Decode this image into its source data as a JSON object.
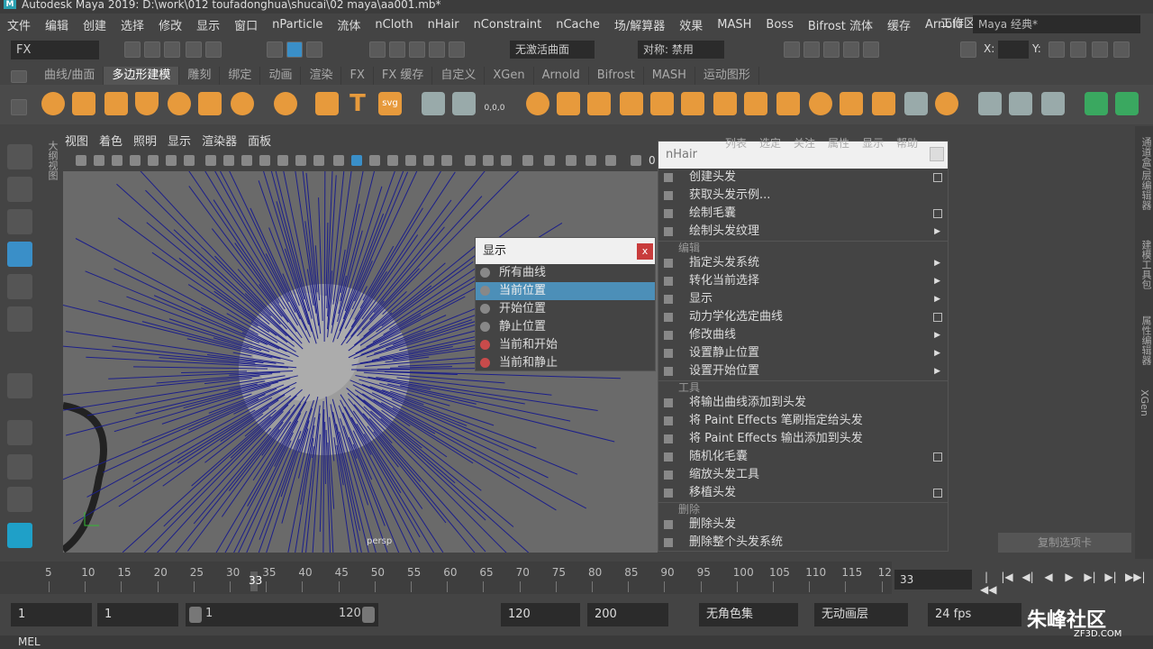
{
  "app": {
    "title": "Autodesk Maya 2019: D:\\work\\012 toufadonghua\\shucai\\02 maya\\aa001.mb*",
    "logo": "M"
  },
  "menubar": [
    "文件",
    "编辑",
    "创建",
    "选择",
    "修改",
    "显示",
    "窗口",
    "nParticle",
    "流体",
    "nCloth",
    "nHair",
    "nConstraint",
    "nCache",
    "场/解算器",
    "效果",
    "MASH",
    "Boss",
    "Bifrost 流体",
    "缓存",
    "Arnold"
  ],
  "workspace": {
    "label": "工作区:",
    "value": "Maya 经典*"
  },
  "status": {
    "mode": "FX",
    "live": "无激活曲面",
    "symmetry": "对称: 禁用",
    "x_label": "X:",
    "y_label": "Y:"
  },
  "shelf_tabs": [
    {
      "label": "曲线/曲面",
      "active": false
    },
    {
      "label": "多边形建模",
      "active": true
    },
    {
      "label": "雕刻",
      "active": false
    },
    {
      "label": "绑定",
      "active": false
    },
    {
      "label": "动画",
      "active": false
    },
    {
      "label": "渲染",
      "active": false
    },
    {
      "label": "FX",
      "active": false
    },
    {
      "label": "FX 缓存",
      "active": false
    },
    {
      "label": "自定义",
      "active": false
    },
    {
      "label": "XGen",
      "active": false
    },
    {
      "label": "Arnold",
      "active": false
    },
    {
      "label": "Bifrost",
      "active": false
    },
    {
      "label": "MASH",
      "active": false
    },
    {
      "label": "运动图形",
      "active": false
    }
  ],
  "shelf_text": {
    "t_icon": "T",
    "svg_icon": "svg",
    "coord_icon": "0,0,0"
  },
  "outliner_label": "大纲视图",
  "viewport": {
    "menus": [
      "视图",
      "着色",
      "照明",
      "显示",
      "渲染器",
      "面板"
    ],
    "camera": "persp",
    "cropped_value": "0"
  },
  "display_popup": {
    "title": "显示",
    "close": "x",
    "items": [
      {
        "label": "所有曲线",
        "highlight": false
      },
      {
        "label": "当前位置",
        "highlight": true
      },
      {
        "label": "开始位置",
        "highlight": false
      },
      {
        "label": "静止位置",
        "highlight": false
      },
      {
        "label": "当前和开始",
        "highlight": false
      },
      {
        "label": "当前和静止",
        "highlight": false
      }
    ]
  },
  "nhair_menu": {
    "title": "nHair",
    "section1": [
      {
        "label": "创建头发",
        "opt": "box"
      },
      {
        "label": "获取头发示例...",
        "opt": ""
      },
      {
        "label": "绘制毛囊",
        "opt": "box"
      },
      {
        "label": "绘制头发纹理",
        "opt": "arrow"
      }
    ],
    "sec_edit": "编辑",
    "section2": [
      {
        "label": "指定头发系统",
        "opt": "arrow"
      },
      {
        "label": "转化当前选择",
        "opt": "arrow"
      },
      {
        "label": "显示",
        "opt": "arrow"
      },
      {
        "label": "动力学化选定曲线",
        "opt": "box"
      },
      {
        "label": "修改曲线",
        "opt": "arrow"
      },
      {
        "label": "设置静止位置",
        "opt": "arrow"
      },
      {
        "label": "设置开始位置",
        "opt": "arrow"
      }
    ],
    "sec_tools": "工具",
    "section3": [
      {
        "label": "将输出曲线添加到头发",
        "opt": ""
      },
      {
        "label": "将 Paint Effects 笔刷指定给头发",
        "opt": ""
      },
      {
        "label": "将 Paint Effects 输出添加到头发",
        "opt": ""
      },
      {
        "label": "随机化毛囊",
        "opt": "box"
      },
      {
        "label": "缩放头发工具",
        "opt": ""
      },
      {
        "label": "移植头发",
        "opt": "box"
      }
    ],
    "sec_delete": "删除",
    "section4": [
      {
        "label": "删除头发",
        "opt": ""
      },
      {
        "label": "删除整个头发系统",
        "opt": ""
      }
    ]
  },
  "right_panel": {
    "tabs": [
      "列表",
      "选定",
      "关注",
      "属性",
      "显示",
      "帮助"
    ],
    "copy_tab": "复制选项卡"
  },
  "right_sidebar": [
    "通道盒/层编辑器",
    "建模工具包",
    "属性编辑器",
    "XGen"
  ],
  "timeline": {
    "ticks": [
      "5",
      "10",
      "15",
      "20",
      "25",
      "30",
      "35",
      "40",
      "45",
      "50",
      "55",
      "60",
      "65",
      "70",
      "75",
      "80",
      "85",
      "90",
      "95",
      "100",
      "105",
      "110",
      "115",
      "12"
    ],
    "current_label": "33",
    "current_frame": "33"
  },
  "playback": [
    "|◀◀",
    "|◀",
    "◀|",
    "◀",
    "▶",
    "▶|",
    "▶|",
    "▶▶|"
  ],
  "range": {
    "start": "1",
    "start2": "1",
    "slider_start": "1",
    "slider_end": "120",
    "end": "120",
    "end2": "200",
    "character_set": "无角色集",
    "anim_layer": "无动画层",
    "fps": "24 fps"
  },
  "cmdline": "MEL",
  "watermark": {
    "text": "朱峰社区",
    "url": "ZF3D.COM"
  }
}
